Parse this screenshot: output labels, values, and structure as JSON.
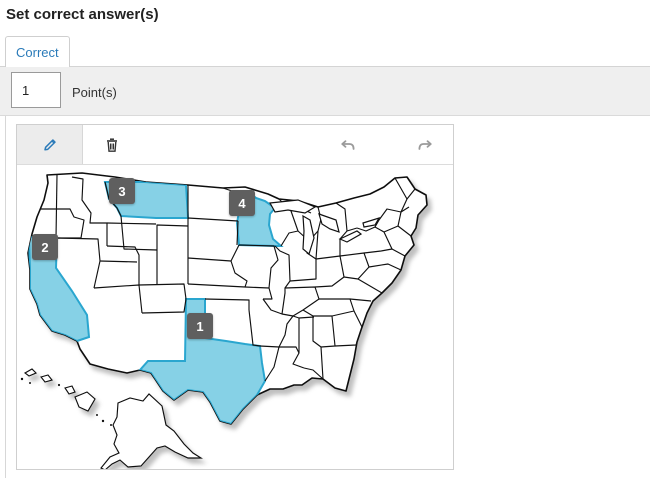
{
  "header": {
    "title": "Set correct answer(s)"
  },
  "tabs": [
    {
      "label": "Correct"
    }
  ],
  "points": {
    "value": "1",
    "label": "Point(s)"
  },
  "toolbar": {
    "tools": [
      {
        "icon": "pencil-icon",
        "active": true
      },
      {
        "icon": "trash-icon",
        "active": false
      },
      {
        "icon": "undo-icon",
        "active": false
      },
      {
        "icon": "redo-icon",
        "active": false
      }
    ]
  },
  "map": {
    "markers": [
      {
        "label": "1",
        "region": "Texas"
      },
      {
        "label": "2",
        "region": "California"
      },
      {
        "label": "3",
        "region": "Montana"
      },
      {
        "label": "4",
        "region": "Minnesota"
      }
    ],
    "highlight_color": "#86d1e6",
    "highlight_stroke": "#2aa6cf"
  }
}
